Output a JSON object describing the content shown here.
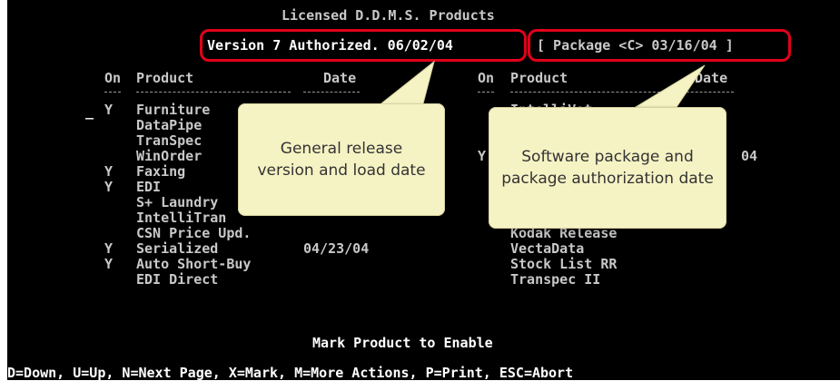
{
  "title": "Licensed D.D.M.S. Products",
  "version_line": "Version 7 Authorized. 06/02/04",
  "package_line": "[ Package <C> 03/16/04 ]",
  "left_headers": {
    "on": "On",
    "product": "Product",
    "date": "Date"
  },
  "right_headers": {
    "on": "On",
    "product": "Product",
    "date": "Date"
  },
  "cursor": "_",
  "left_products": [
    {
      "on": "Y",
      "name": "Furniture",
      "date": ""
    },
    {
      "on": "",
      "name": "DataPipe",
      "date": ""
    },
    {
      "on": "",
      "name": "TranSpec",
      "date": ""
    },
    {
      "on": "",
      "name": "WinOrder",
      "date": ""
    },
    {
      "on": "Y",
      "name": "Faxing",
      "date": ""
    },
    {
      "on": "Y",
      "name": "EDI",
      "date": ""
    },
    {
      "on": "",
      "name": "S+ Laundry",
      "date": ""
    },
    {
      "on": "",
      "name": "IntelliTran",
      "date": ""
    },
    {
      "on": "",
      "name": "CSN Price Upd.",
      "date": ""
    },
    {
      "on": "Y",
      "name": "Serialized",
      "date": "04/23/04"
    },
    {
      "on": "Y",
      "name": "Auto Short-Buy",
      "date": ""
    },
    {
      "on": "",
      "name": "EDI Direct",
      "date": ""
    }
  ],
  "right_products": [
    {
      "on": "",
      "name": "IntelliVet",
      "date": ""
    },
    {
      "on": "Y",
      "name": "",
      "date": "04"
    },
    {
      "on": "",
      "name": "Kodak Release",
      "date": ""
    },
    {
      "on": "",
      "name": "VectaData",
      "date": ""
    },
    {
      "on": "",
      "name": "Stock List RR",
      "date": ""
    },
    {
      "on": "",
      "name": "Transpec II",
      "date": ""
    }
  ],
  "callout_left": {
    "line1": "General release",
    "line2": "version and load date"
  },
  "callout_right": {
    "line1": "Software package and",
    "line2": "package authorization date"
  },
  "prompt": "Mark Product to Enable",
  "keys_help": "D=Down, U=Up, N=Next Page, X=Mark, M=More Actions, P=Print, ESC=Abort",
  "colors": {
    "annotation_red": "#e2001a",
    "callout_fill": "#f5f3c4",
    "screen_bg": "#000000",
    "text": "#c8c8c8"
  }
}
